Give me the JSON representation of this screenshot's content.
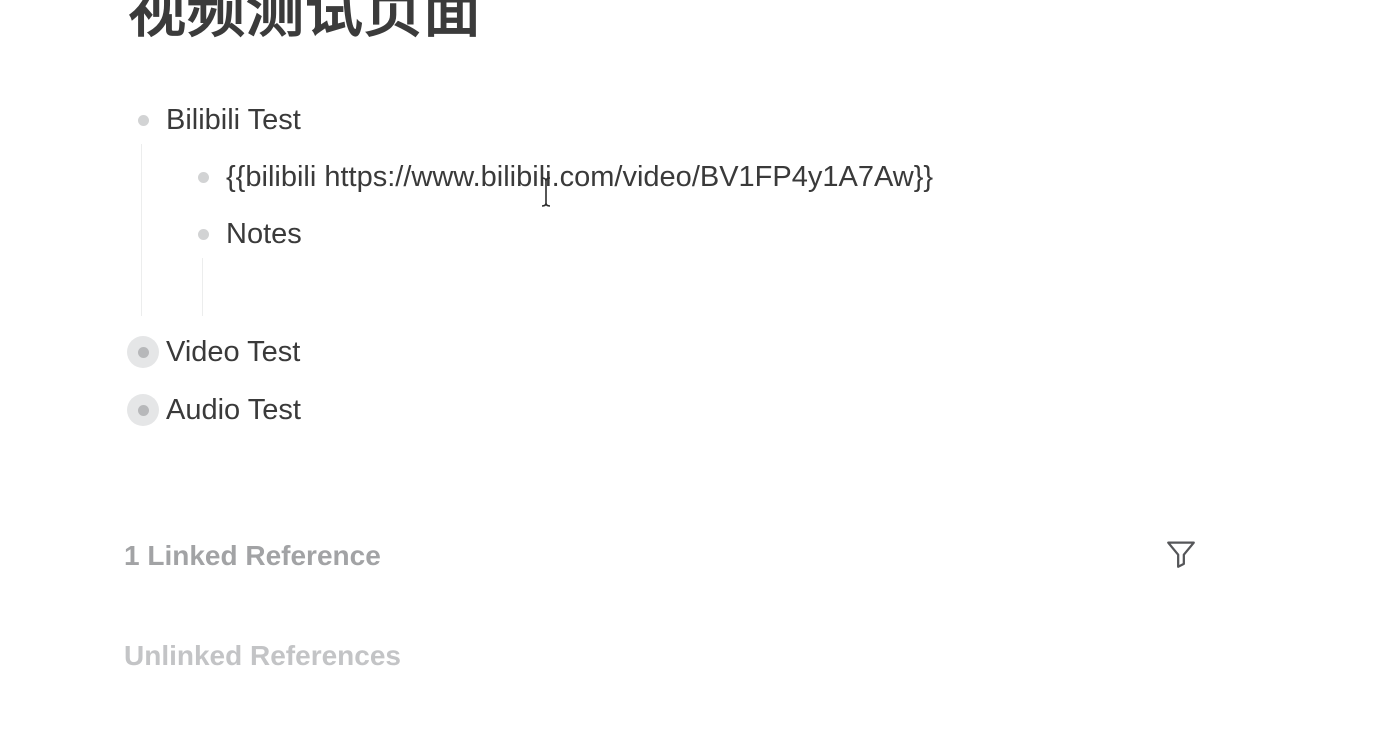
{
  "page": {
    "title": "视频测试页面"
  },
  "blocks": [
    {
      "text": "Bilibili Test",
      "children": [
        {
          "text": "{{bilibili https://www.bilibili.com/video/BV1FP4y1A7Aw}}"
        },
        {
          "text": "Notes"
        }
      ]
    },
    {
      "text": "Video Test",
      "collapsed": true
    },
    {
      "text": "Audio Test",
      "collapsed": true
    }
  ],
  "references": {
    "linked_label": "1 Linked Reference",
    "unlinked_label": "Unlinked References"
  },
  "icons": {
    "filter": "filter-icon",
    "cursor": "text-cursor-icon"
  },
  "colors": {
    "text": "#3a3a3a",
    "bullet": "#d2d3d4",
    "collapsed_ring": "#e5e6e7",
    "linked_ref": "#a2a3a5",
    "unlinked_ref": "#c3c4c6"
  }
}
